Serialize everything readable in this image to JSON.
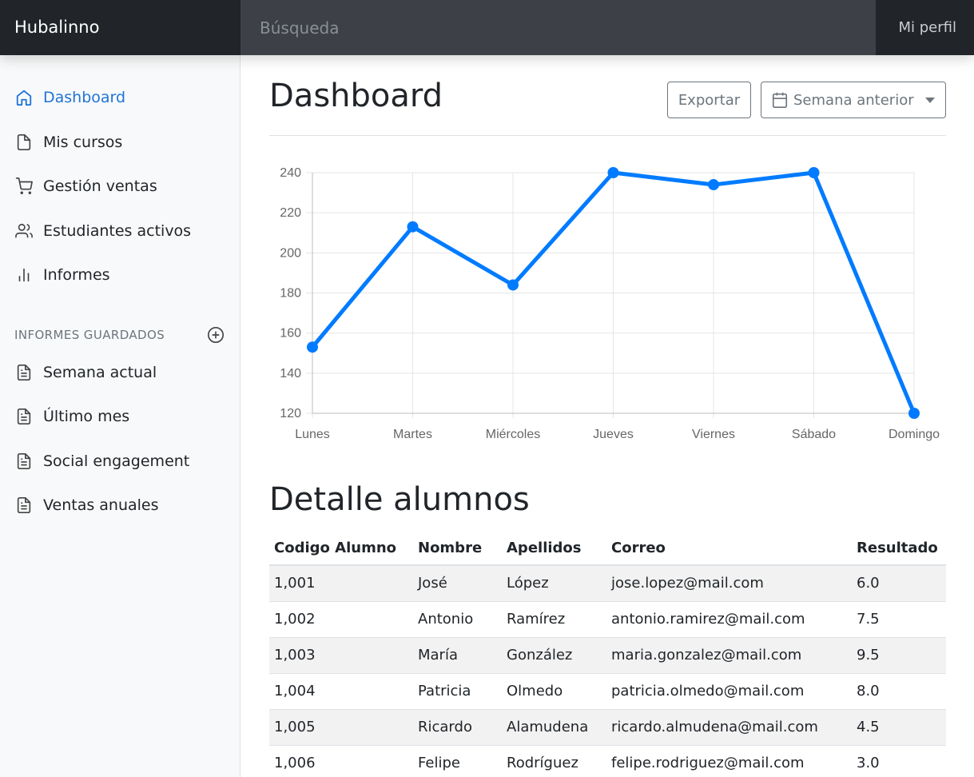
{
  "navbar": {
    "brand": "Hubalinno",
    "search_placeholder": "Búsqueda",
    "profile": "Mi perfil"
  },
  "sidebar": {
    "items": [
      {
        "label": "Dashboard",
        "icon": "home-icon",
        "active": true
      },
      {
        "label": "Mis cursos",
        "icon": "file-icon"
      },
      {
        "label": "Gestión ventas",
        "icon": "shopping-cart-icon"
      },
      {
        "label": "Estudiantes activos",
        "icon": "users-icon"
      },
      {
        "label": "Informes",
        "icon": "bar-chart-icon"
      }
    ],
    "saved_heading": "INFORMES GUARDADOS",
    "saved_items": [
      {
        "label": "Semana actual",
        "icon": "file-text-icon"
      },
      {
        "label": "Último mes",
        "icon": "file-text-icon"
      },
      {
        "label": "Social engagement",
        "icon": "file-text-icon"
      },
      {
        "label": "Ventas anuales",
        "icon": "file-text-icon"
      }
    ]
  },
  "main": {
    "title": "Dashboard",
    "export_label": "Exportar",
    "period_label": "Semana anterior",
    "table_title": "Detalle alumnos"
  },
  "colors": {
    "accent": "#1f74d8",
    "line": "#007bff",
    "navbar": "#343a40"
  },
  "chart_data": {
    "type": "line",
    "categories": [
      "Lunes",
      "Martes",
      "Miércoles",
      "Jueves",
      "Viernes",
      "Sábado",
      "Domingo"
    ],
    "series": [
      {
        "values": [
          153,
          213,
          184,
          240,
          234,
          240,
          120
        ]
      }
    ],
    "ylim": [
      120,
      240
    ],
    "yticks": [
      120,
      140,
      160,
      180,
      200,
      220,
      240
    ],
    "grid": true,
    "legend": "none"
  },
  "table": {
    "headers": [
      "Codigo Alumno",
      "Nombre",
      "Apellidos",
      "Correo",
      "Resultado"
    ],
    "rows": [
      [
        "1,001",
        "José",
        "López",
        "jose.lopez@mail.com",
        "6.0"
      ],
      [
        "1,002",
        "Antonio",
        "Ramírez",
        "antonio.ramirez@mail.com",
        "7.5"
      ],
      [
        "1,003",
        "María",
        "González",
        "maria.gonzalez@mail.com",
        "9.5"
      ],
      [
        "1,004",
        "Patricia",
        "Olmedo",
        "patricia.olmedo@mail.com",
        "8.0"
      ],
      [
        "1,005",
        "Ricardo",
        "Alamudena",
        "ricardo.almudena@mail.com",
        "4.5"
      ],
      [
        "1,006",
        "Felipe",
        "Rodríguez",
        "felipe.rodriguez@mail.com",
        "3.0"
      ]
    ]
  }
}
